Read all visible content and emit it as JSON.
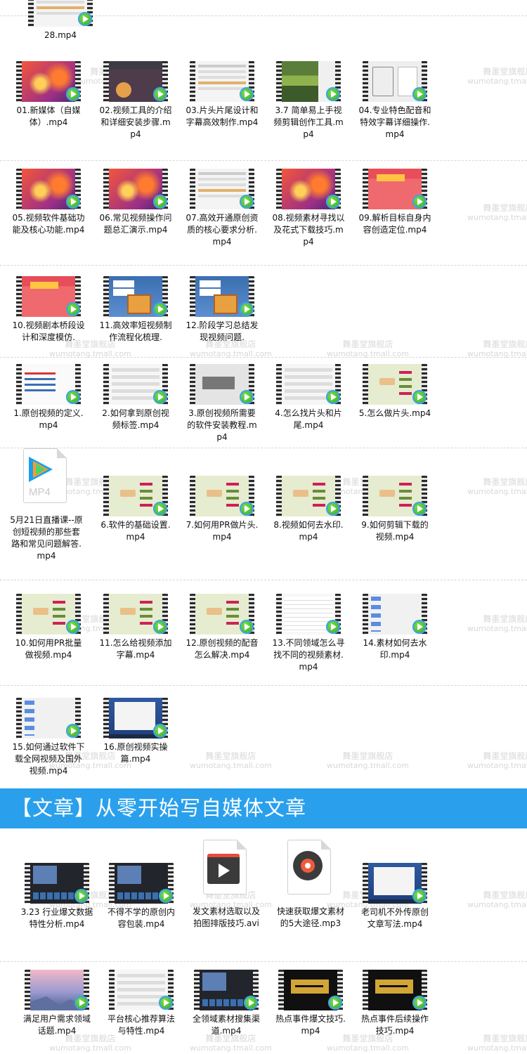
{
  "section1": {
    "files": [
      {
        "name": "28.mp4",
        "thumb": "s-doc"
      },
      {
        "name": "01.新媒体（自媒体）.mp4",
        "thumb": "s-red"
      },
      {
        "name": "02.视频工具的介绍和详细安装步骤.mp4",
        "thumb": "s-dark"
      },
      {
        "name": "03.片头片尾设计和字幕高效制作.mp4",
        "thumb": "s-doc"
      },
      {
        "name": "3.7 简单易上手视频剪辑创作工具.mp4",
        "thumb": "s-green"
      },
      {
        "name": "04.专业特色配音和特效字幕详细操作.mp4",
        "thumb": "s-tips"
      },
      {
        "name": "05.视频软件基础功能及核心功能.mp4",
        "thumb": "s-red"
      },
      {
        "name": "06.常见视频操作问题总汇演示.mp4",
        "thumb": "s-red"
      },
      {
        "name": "07.高效开通原创资质的核心要求分析.mp4",
        "thumb": "s-doc"
      },
      {
        "name": "08.视频素材寻找以及花式下载技巧.mp4",
        "thumb": "s-red"
      },
      {
        "name": "09.解析目标自身内容创造定位.mp4",
        "thumb": "s-pink"
      },
      {
        "name": "10.视频剧本桥段设计和深度模仿.",
        "thumb": "s-pink"
      },
      {
        "name": "11.高效率短视频制作流程化梳理.",
        "thumb": "s-cube"
      },
      {
        "name": "12.阶段学习总结发现视频问题.",
        "thumb": "s-cube"
      },
      {
        "name": "1.原创视频的定义.mp4",
        "thumb": "s-white"
      },
      {
        "name": "2.如何拿到原创视频标签.mp4",
        "thumb": "s-white2"
      },
      {
        "name": "3.原创视频所需要的软件安装教程.mp4",
        "thumb": "s-gray"
      },
      {
        "name": "4.怎么找片头和片尾.mp4",
        "thumb": "s-white2"
      },
      {
        "name": "5.怎么做片头.mp4",
        "thumb": "s-mind"
      },
      {
        "name": "5月21日直播课--原创短视频的那些套路和常见问题解答.mp4",
        "thumb": "mp4-icon"
      },
      {
        "name": "6.软件的基础设置.mp4",
        "thumb": "s-mind"
      },
      {
        "name": "7.如何用PR做片头.mp4",
        "thumb": "s-mind"
      },
      {
        "name": "8.视频如何去水印.mp4",
        "thumb": "s-mind"
      },
      {
        "name": "9.如何剪辑下载的视频.mp4",
        "thumb": "s-mind"
      },
      {
        "name": "10.如何用PR批量做视频.mp4",
        "thumb": "s-mind"
      },
      {
        "name": "11.怎么给视频添加字幕.mp4",
        "thumb": "s-mind"
      },
      {
        "name": "12.原创视频的配音怎么解决.mp4",
        "thumb": "s-mind"
      },
      {
        "name": "13.不同领域怎么寻找不同的视频素材.mp4",
        "thumb": "s-table"
      },
      {
        "name": "14.素材如何去水印.mp4",
        "thumb": "s-desk"
      },
      {
        "name": "15.如何通过软件下载全网视频及国外视频.mp4",
        "thumb": "s-desk"
      },
      {
        "name": "16.原创视频实操篇.mp4",
        "thumb": "s-win"
      }
    ]
  },
  "banner": {
    "title": "【文章】从零开始写自媒体文章",
    "color": "#2aa0ec"
  },
  "section2": {
    "files": [
      {
        "name": "3.23 行业爆文数据特性分析.mp4",
        "thumb": "s-edit"
      },
      {
        "name": "不得不学的原创内容包装.mp4",
        "thumb": "s-edit"
      },
      {
        "name": "发文素材选取以及拍图排版技巧.avi",
        "thumb": "avi-icon"
      },
      {
        "name": "快速获取爆文素材的5大途径.mp3",
        "thumb": "mp3-icon"
      },
      {
        "name": "老司机不外传原创文章写法.mp4",
        "thumb": "s-win"
      },
      {
        "name": "满足用户需求领域话题.mp4",
        "thumb": "s-sky"
      },
      {
        "name": "平台核心推荐算法与特性.mp4",
        "thumb": "s-white2"
      },
      {
        "name": "全领域素材搜集渠道.mp4",
        "thumb": "s-edit"
      },
      {
        "name": "热点事件爆文技巧.mp4",
        "thumb": "s-black"
      },
      {
        "name": "热点事件后续操作技巧.mp4",
        "thumb": "s-black"
      }
    ]
  },
  "icons": {
    "mp4_label": "MP4",
    "play_badge": "play-badge-icon"
  },
  "watermark": {
    "cn": "舞墨堂旗舰店",
    "en": "wumotang.tmall.com"
  }
}
